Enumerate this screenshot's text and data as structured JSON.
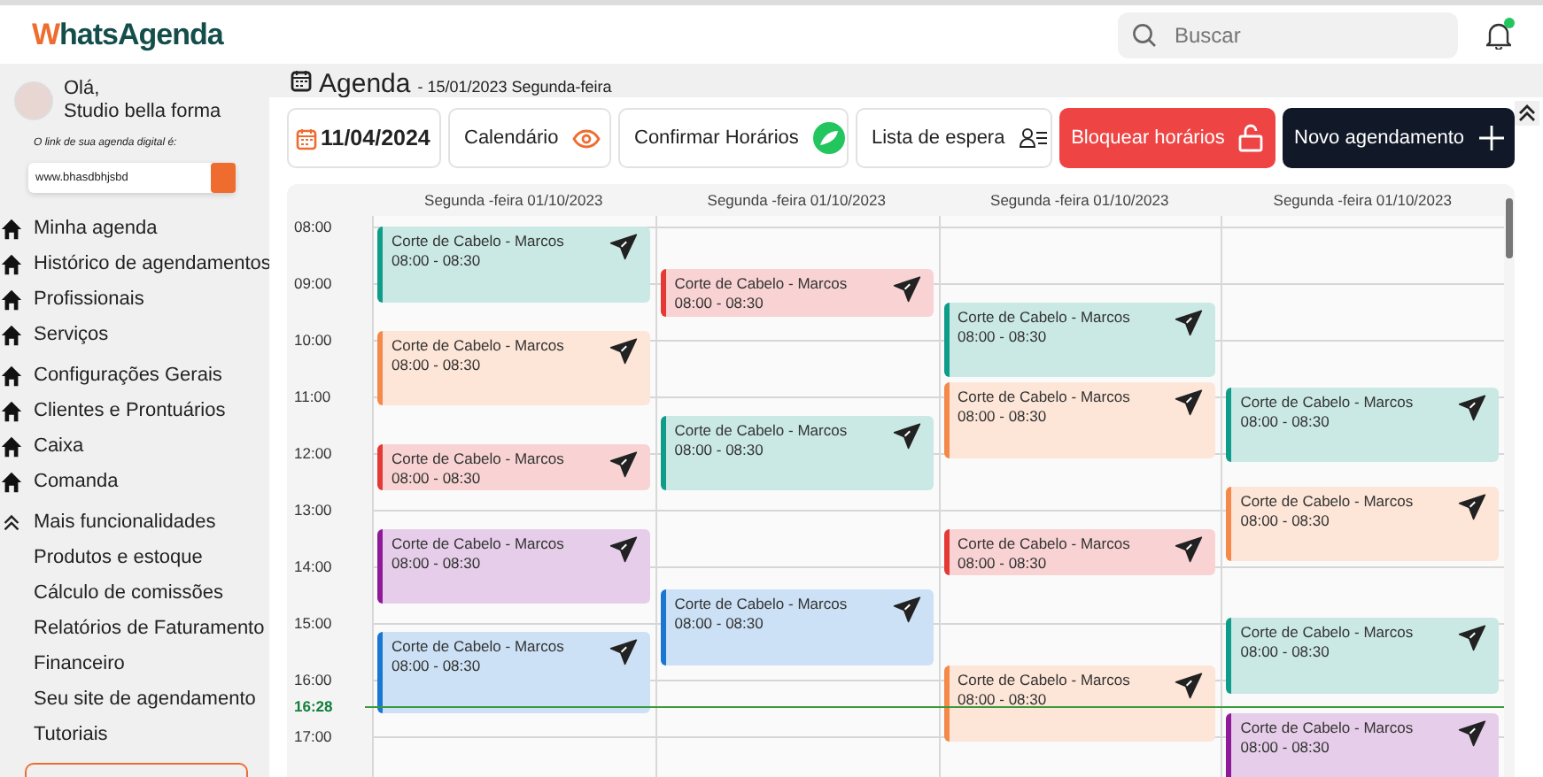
{
  "header": {
    "logo": "WhatsAgenda",
    "search": {
      "placeholder": "Buscar"
    },
    "notifications": {
      "unread": true
    }
  },
  "sidebar": {
    "greeting": "Olá,",
    "user": "Studio bella forma",
    "link_label": "O link de sua agenda digital é:",
    "link_value": "www.bhasdbhjsbd",
    "items": [
      {
        "label": "Minha agenda",
        "kind": "main"
      },
      {
        "label": "Histórico de agendamentos",
        "kind": "main"
      },
      {
        "label": "Profissionais",
        "kind": "main"
      },
      {
        "label": "Serviços",
        "kind": "main"
      },
      {
        "label": "Configurações Gerais",
        "kind": "main"
      },
      {
        "label": "Clientes e Prontuários",
        "kind": "main"
      },
      {
        "label": "Caixa",
        "kind": "main"
      },
      {
        "label": "Comanda",
        "kind": "main"
      },
      {
        "label": "Mais funcionalidades",
        "kind": "group",
        "expanded": true
      },
      {
        "label": "Produtos e estoque",
        "kind": "sub"
      },
      {
        "label": "Cálculo de comissões",
        "kind": "sub"
      },
      {
        "label": "Relatórios de Faturamento",
        "kind": "sub"
      },
      {
        "label": "Financeiro",
        "kind": "sub"
      },
      {
        "label": "Seu site de agendamento",
        "kind": "sub"
      },
      {
        "label": "Tutoriais",
        "kind": "sub"
      }
    ]
  },
  "page": {
    "title": "Agenda",
    "subtitle": "- 15/01/2023 Segunda-feira"
  },
  "toolbar": [
    {
      "label": "11/04/2024",
      "kind": "date"
    },
    {
      "label": "Calendário",
      "kind": "calendar"
    },
    {
      "label": "Confirmar Horários",
      "kind": "confirm"
    },
    {
      "label": "Lista de espera",
      "kind": "waitlist"
    },
    {
      "label": "Bloquear horários",
      "kind": "block"
    },
    {
      "label": "Novo agendamento",
      "kind": "new"
    }
  ],
  "calendar": {
    "hours": [
      "08:00",
      "09:00",
      "10:00",
      "11:00",
      "12:00",
      "13:00",
      "14:00",
      "15:00",
      "16:00",
      "17:00"
    ],
    "now": "16:28",
    "columns": [
      {
        "header": "Segunda -feira 01/10/2023",
        "events": [
          {
            "title": "Corte de Cabelo - Marcos",
            "time": "08:00 - 08:30",
            "color": "#0f9d8a"
          },
          {
            "title": "Corte de Cabelo - Marcos",
            "time": "08:00 - 08:30",
            "color": "#f4894a"
          },
          {
            "title": "Corte de Cabelo - Marcos",
            "time": "08:00 - 08:30",
            "color": "#e53935"
          },
          {
            "title": "Corte de Cabelo - Marcos",
            "time": "08:00 - 08:30",
            "color": "#8e1a9a"
          },
          {
            "title": "Corte de Cabelo - Marcos",
            "time": "08:00 - 08:30",
            "color": "#1976d2"
          }
        ]
      },
      {
        "header": "Segunda -feira 01/10/2023",
        "events": [
          {
            "title": "Corte de Cabelo - Marcos",
            "time": "08:00 - 08:30",
            "color": "#e53935"
          },
          {
            "title": "Corte de Cabelo - Marcos",
            "time": "08:00 - 08:30",
            "color": "#0f9d8a"
          },
          {
            "title": "Corte de Cabelo - Marcos",
            "time": "08:00 - 08:30",
            "color": "#1976d2"
          }
        ]
      },
      {
        "header": "Segunda -feira 01/10/2023",
        "events": [
          {
            "title": "Corte de Cabelo - Marcos",
            "time": "08:00 - 08:30",
            "color": "#0f9d8a"
          },
          {
            "title": "Corte de Cabelo - Marcos",
            "time": "08:00 - 08:30",
            "color": "#f4894a"
          },
          {
            "title": "Corte de Cabelo - Marcos",
            "time": "08:00 - 08:30",
            "color": "#e53935"
          },
          {
            "title": "Corte de Cabelo - Marcos",
            "time": "08:00 - 08:30",
            "color": "#f4894a"
          }
        ]
      },
      {
        "header": "Segunda -feira 01/10/2023",
        "events": [
          {
            "title": "Corte de Cabelo - Marcos",
            "time": "08:00 - 08:30",
            "color": "#0f9d8a"
          },
          {
            "title": "Corte de Cabelo - Marcos",
            "time": "08:00 - 08:30",
            "color": "#f4894a"
          },
          {
            "title": "Corte de Cabelo - Marcos",
            "time": "08:00 - 08:30",
            "color": "#0f9d8a"
          },
          {
            "title": "Corte de Cabelo - Marcos",
            "time": "08:00 - 08:30",
            "color": "#8e1a9a"
          }
        ]
      }
    ]
  }
}
